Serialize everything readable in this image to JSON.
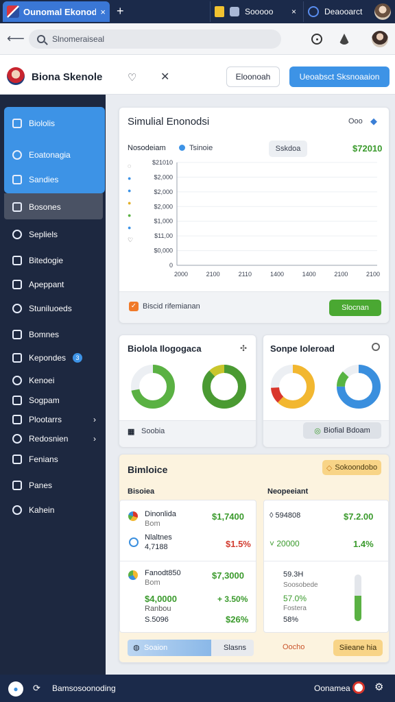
{
  "browser": {
    "active_tab_title": "Ounomal Ekonodic",
    "tab2_label": "Sooooo",
    "tab3_label": "Deaooarct",
    "new_tab": "+",
    "close": "×",
    "omnibox_text": "Slnomeraiseal"
  },
  "header": {
    "brand": "Biona Skenole",
    "secondary_button": "Eloonoah",
    "primary_button": "Ueoabsct Sksnoaaion"
  },
  "sidebar": {
    "items": [
      {
        "label": "Biololis",
        "icon": "layers-icon"
      },
      {
        "label": "Eoatonagia",
        "icon": "gear-icon"
      },
      {
        "label": "Sandies",
        "icon": "monitor-icon"
      },
      {
        "label": "Bosones",
        "icon": "camera-icon"
      },
      {
        "label": "Sepliels",
        "icon": "share-icon"
      },
      {
        "label": "Bitedogie",
        "icon": "home-icon"
      },
      {
        "label": "Apeppant",
        "icon": "target-icon"
      },
      {
        "label": "Stuniluoeds",
        "icon": "download-icon"
      },
      {
        "label": "Bomnes",
        "icon": "list-icon"
      },
      {
        "label": "Kepondes",
        "icon": "gift-icon",
        "badge": "3"
      },
      {
        "label": "Kenoei",
        "icon": "file-icon"
      },
      {
        "label": "Sogpam",
        "icon": "lock-icon"
      },
      {
        "label": "Plootarrs",
        "icon": "doc-icon",
        "chevron": "›"
      },
      {
        "label": "Redosnien",
        "icon": "edit-icon",
        "chevron": "›"
      },
      {
        "label": "Fenians",
        "icon": "search-icon"
      },
      {
        "label": "Panes",
        "icon": "menu-icon"
      },
      {
        "label": "Kahein",
        "icon": "search-icon"
      }
    ]
  },
  "main_card": {
    "title": "Simulial Enonodsi",
    "title_extra": "Ooo",
    "legend_label": "Nosodeiam",
    "legend_item": "Tsinoie",
    "pill": "Sskdoa",
    "value": "$72010",
    "footer_text": "Biscid rifemianan",
    "footer_button": "Slocnan"
  },
  "chart_data": {
    "type": "line",
    "x": [
      "2000",
      "2100",
      "2110",
      "1400",
      "1400",
      "2100",
      "2100"
    ],
    "y_ticks": [
      "$21010",
      "$2,000",
      "$2,000",
      "$2,000",
      "$1,000",
      "$11,00",
      "$0,000",
      "0"
    ],
    "series": [],
    "ylim": [
      0,
      35
    ],
    "grid": true
  },
  "card_left": {
    "title": "Biolola Ilogogaca",
    "footer_label": "Soobia"
  },
  "card_right": {
    "title": "Sonpe Ioleroad",
    "footer_button": "Biofial Bdoam"
  },
  "donuts": [
    {
      "fraction": 0.72,
      "color": "#5ab143"
    },
    {
      "fraction": 0.88,
      "color": "#4a9a32",
      "accent": "#c9c62c"
    },
    {
      "fraction": 0.62,
      "color": "#f2b730",
      "accent": "#d9362c"
    },
    {
      "fraction": 0.75,
      "color": "#3a8fde",
      "accent": "#57b443"
    }
  ],
  "bottom_card": {
    "title": "Bimloice",
    "badge": "Sokoondobo",
    "left_heading": "Bisoiea",
    "right_heading": "Neopeeiant",
    "left_rows": [
      {
        "name": "Dinonlida",
        "sub": "Bom",
        "value": "$1,7400",
        "value_color": "green"
      },
      {
        "name": "Nlaltnes",
        "sub": "4,7188",
        "value": "$1.5%",
        "value_color": "red"
      },
      {
        "name": "Fanodt850",
        "sub": "Bom",
        "value": "$7,3000",
        "value_color": "green"
      },
      {
        "name": "$4,0000",
        "sub": "Ranbou",
        "value": "+ 3.50%",
        "value_color": "green"
      },
      {
        "name": "S.5096",
        "sub": "",
        "value": "$26%",
        "value_color": "green"
      }
    ],
    "right_rows": [
      {
        "left": "◊ 594808",
        "right": "$7.2.00",
        "right_color": "green"
      },
      {
        "left": "˅ 20000",
        "right": "1.4%",
        "right_color": "green"
      },
      {
        "left": "59.3H",
        "right": "",
        "right_color": "green"
      },
      {
        "left": "Soosobede",
        "right": "",
        "right_color": "green"
      },
      {
        "left": "57.0%",
        "right": "",
        "right_color": "green"
      },
      {
        "left": "Fostera",
        "right": "",
        "right_color": "green"
      },
      {
        "left": "58%",
        "right": "",
        "right_color": "green"
      }
    ],
    "progress_fraction": 0.55,
    "left_footer_label": "Soaion",
    "left_footer_value": "Slasns",
    "right_footer_label": "Oocho",
    "right_footer_button": "Siieane hia"
  },
  "statusbar": {
    "label": "Bamsosoonoding",
    "right_label": "Oonamea"
  }
}
